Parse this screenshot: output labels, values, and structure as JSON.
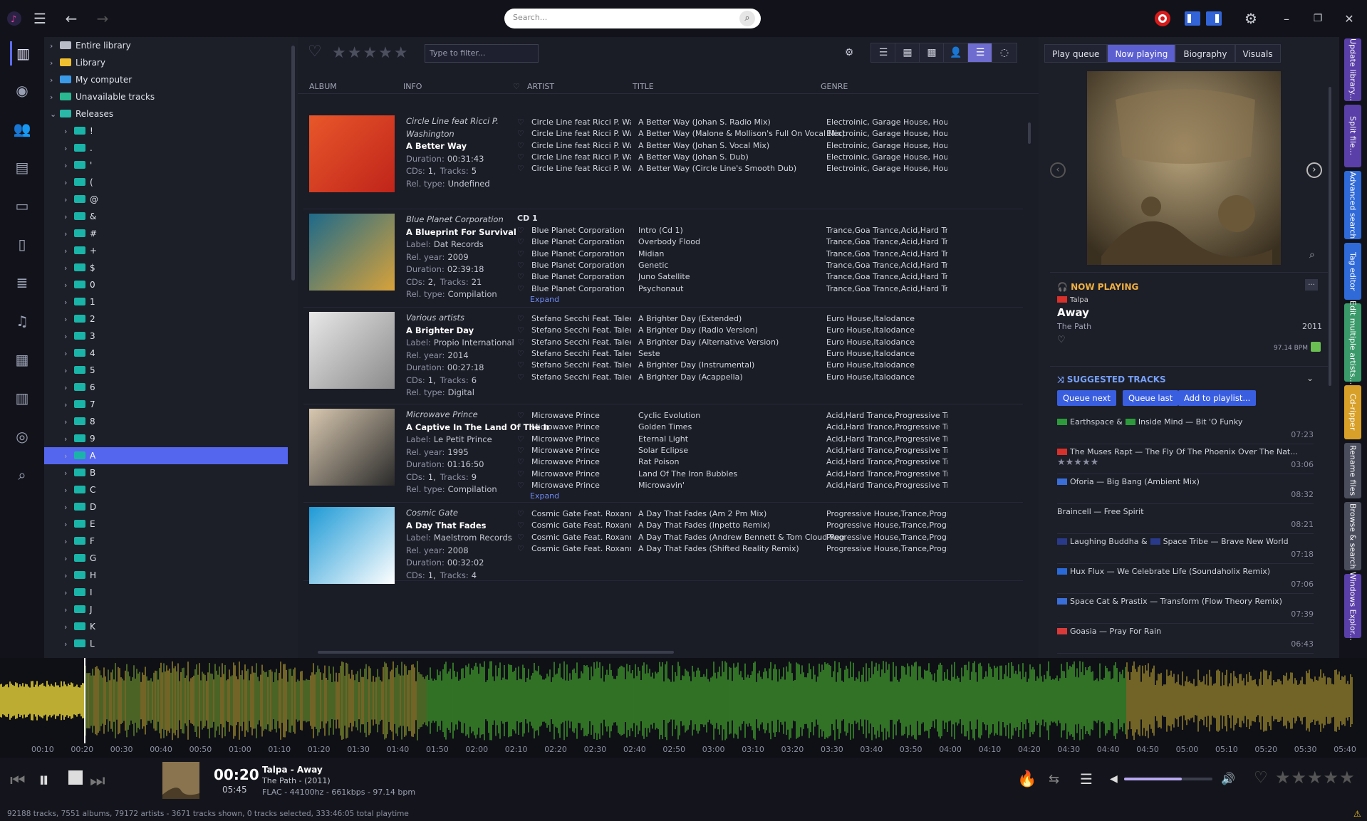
{
  "app": {
    "logo": "musicbee-logo"
  },
  "topbar": {
    "search_placeholder": "Search...",
    "menu_icon": "hamburger-icon",
    "back_icon": "back-arrow-icon",
    "forward_icon": "forward-arrow-icon"
  },
  "tree": {
    "items": [
      {
        "label": "Entire library",
        "level": 0,
        "icon": "database-icon"
      },
      {
        "label": "Library",
        "level": 0,
        "icon": "folder-icon"
      },
      {
        "label": "My computer",
        "level": 0,
        "icon": "computer-icon"
      },
      {
        "label": "Unavailable tracks",
        "level": 0,
        "icon": "unavailable-icon"
      },
      {
        "label": "Releases",
        "level": 0,
        "icon": "releases-icon",
        "expanded": true
      }
    ],
    "release_folders": [
      "!",
      ".",
      "'",
      "(",
      "@",
      "&",
      "#",
      "+",
      "$",
      "0",
      "1",
      "2",
      "3",
      "4",
      "5",
      "6",
      "7",
      "8",
      "9",
      "A",
      "B",
      "C",
      "D",
      "E",
      "F",
      "G",
      "H",
      "I",
      "J",
      "K",
      "L"
    ],
    "selected": "A"
  },
  "center": {
    "filter_placeholder": "Type to filter...",
    "columns": {
      "album": "ALBUM",
      "info": "INFO",
      "artist": "ARTIST",
      "title": "TITLE",
      "genre": "GENRE"
    },
    "expand_label": "Expand",
    "albums": [
      {
        "artist": "Circle Line feat Ricci P. Washington",
        "title": "A Better Way",
        "duration_label": "Duration:",
        "duration": "00:31:43",
        "cds_label": "CDs:",
        "cds": "1,",
        "tracks_label": "Tracks:",
        "tracks": "5",
        "reltype_label": "Rel. type:",
        "reltype": "Undefined",
        "colors": [
          "#e8572a",
          "#c0241a"
        ],
        "rows": [
          {
            "artist": "Circle Line feat Ricci P. Wa...",
            "title": "A Better Way (Johan S. Radio Mix)",
            "genre": "Electroinic, Garage House, House"
          },
          {
            "artist": "Circle Line feat Ricci P. Wa...",
            "title": "A Better Way (Malone & Mollison's Full On Vocal Mix)",
            "genre": "Electroinic, Garage House, House"
          },
          {
            "artist": "Circle Line feat Ricci P. Wa...",
            "title": "A Better Way (Johan S. Vocal Mix)",
            "genre": "Electroinic, Garage House, House"
          },
          {
            "artist": "Circle Line feat Ricci P. Wa...",
            "title": "A Better Way (Johan S. Dub)",
            "genre": "Electroinic, Garage House, House"
          },
          {
            "artist": "Circle Line feat Ricci P. Wa...",
            "title": "A Better Way (Circle Line's Smooth Dub)",
            "genre": "Electroinic, Garage House, House"
          }
        ]
      },
      {
        "artist": "Blue Planet Corporation",
        "title": "A Blueprint For Survival",
        "label_label": "Label:",
        "label": "Dat Records",
        "year_label": "Rel. year:",
        "year": "2009",
        "duration_label": "Duration:",
        "duration": "02:39:18",
        "cds_label": "CDs:",
        "cds": "2,",
        "tracks_label": "Tracks:",
        "tracks": "21",
        "reltype_label": "Rel. type:",
        "reltype": "Compilation",
        "cd": "CD 1",
        "colors": [
          "#1d6a8a",
          "#d8a23a"
        ],
        "rows": [
          {
            "artist": "Blue Planet Corporation",
            "title": "Intro (Cd 1)",
            "genre": "Trance,Goa Trance,Acid,Hard Tra..."
          },
          {
            "artist": "Blue Planet Corporation",
            "title": "Overbody Flood",
            "genre": "Trance,Goa Trance,Acid,Hard Tra..."
          },
          {
            "artist": "Blue Planet Corporation",
            "title": "Midian",
            "genre": "Trance,Goa Trance,Acid,Hard Tra..."
          },
          {
            "artist": "Blue Planet Corporation",
            "title": "Genetic",
            "genre": "Trance,Goa Trance,Acid,Hard Tra..."
          },
          {
            "artist": "Blue Planet Corporation",
            "title": "Juno Satellite",
            "genre": "Trance,Goa Trance,Acid,Hard Tra..."
          },
          {
            "artist": "Blue Planet Corporation",
            "title": "Psychonaut",
            "genre": "Trance,Goa Trance,Acid,Hard Tra..."
          }
        ]
      },
      {
        "artist": "Various artists",
        "title": "A Brighter Day",
        "label_label": "Label:",
        "label": "Propio International",
        "year_label": "Rel. year:",
        "year": "2014",
        "duration_label": "Duration:",
        "duration": "00:27:18",
        "cds_label": "CDs:",
        "cds": "1,",
        "tracks_label": "Tracks:",
        "tracks": "6",
        "reltype_label": "Rel. type:",
        "reltype": "Digital",
        "colors": [
          "#e8e8e8",
          "#8a8a8a"
        ],
        "rows": [
          {
            "artist": "Stefano Secchi Feat. Taleesa",
            "title": "A Brighter Day (Extended)",
            "genre": "Euro House,Italodance"
          },
          {
            "artist": "Stefano Secchi Feat. Taleesa",
            "title": "A Brighter Day (Radio Version)",
            "genre": "Euro House,Italodance"
          },
          {
            "artist": "Stefano Secchi Feat. Taleesa",
            "title": "A Brighter Day (Alternative Version)",
            "genre": "Euro House,Italodance"
          },
          {
            "artist": "Stefano Secchi Feat. Taleesa",
            "title": "Seste",
            "genre": "Euro House,Italodance"
          },
          {
            "artist": "Stefano Secchi Feat. Taleesa",
            "title": "A Brighter Day (Instrumental)",
            "genre": "Euro House,Italodance"
          },
          {
            "artist": "Stefano Secchi Feat. Taleesa",
            "title": "A Brighter Day (Acappella)",
            "genre": "Euro House,Italodance"
          }
        ]
      },
      {
        "artist": "Microwave Prince",
        "title": "A Captive In The Land Of The Iro...",
        "label_label": "Label:",
        "label": "Le Petit Prince",
        "year_label": "Rel. year:",
        "year": "1995",
        "duration_label": "Duration:",
        "duration": "01:16:50",
        "cds_label": "CDs:",
        "cds": "1,",
        "tracks_label": "Tracks:",
        "tracks": "9",
        "reltype_label": "Rel. type:",
        "reltype": "Compilation",
        "colors": [
          "#d8c8b0",
          "#2a2a2a"
        ],
        "rows": [
          {
            "artist": "Microwave Prince",
            "title": "Cyclic Evolution",
            "genre": "Acid,Hard Trance,Progressive Tra..."
          },
          {
            "artist": "Microwave Prince",
            "title": "Golden Times",
            "genre": "Acid,Hard Trance,Progressive Tra..."
          },
          {
            "artist": "Microwave Prince",
            "title": "Eternal Light",
            "genre": "Acid,Hard Trance,Progressive Tra..."
          },
          {
            "artist": "Microwave Prince",
            "title": "Solar Eclipse",
            "genre": "Acid,Hard Trance,Progressive Tra..."
          },
          {
            "artist": "Microwave Prince",
            "title": "Rat Poison",
            "genre": "Acid,Hard Trance,Progressive Tra..."
          },
          {
            "artist": "Microwave Prince",
            "title": "Land Of The Iron Bubbles",
            "genre": "Acid,Hard Trance,Progressive Tra..."
          },
          {
            "artist": "Microwave Prince",
            "title": "Microwavin'",
            "genre": "Acid,Hard Trance,Progressive Tra..."
          }
        ]
      },
      {
        "artist": "Cosmic Gate",
        "title": "A Day That Fades",
        "label_label": "Label:",
        "label": "Maelstrom Records",
        "year_label": "Rel. year:",
        "year": "2008",
        "duration_label": "Duration:",
        "duration": "00:32:02",
        "cds_label": "CDs:",
        "cds": "1,",
        "tracks_label": "Tracks:",
        "tracks": "4",
        "colors": [
          "#1e9ad6",
          "#ffffff"
        ],
        "rows": [
          {
            "artist": "Cosmic Gate Feat. Roxann...",
            "title": "A Day That Fades (Am 2 Pm Mix)",
            "genre": "Progressive House,Trance,Progr..."
          },
          {
            "artist": "Cosmic Gate Feat. Roxann...",
            "title": "A Day That Fades (Inpetto Remix)",
            "genre": "Progressive House,Trance,Progr..."
          },
          {
            "artist": "Cosmic Gate Feat. Roxann...",
            "title": "A Day That Fades (Andrew Bennett & Tom Cloud Remix)",
            "genre": "Progressive House,Trance,Progr..."
          },
          {
            "artist": "Cosmic Gate Feat. Roxann...",
            "title": "A Day That Fades (Shifted Reality Remix)",
            "genre": "Progressive House,Trance,Progr..."
          }
        ]
      }
    ]
  },
  "right": {
    "tabs": [
      "Play queue",
      "Now playing",
      "Biography",
      "Visuals"
    ],
    "selected_tab": "Now playing",
    "now_playing_label": "NOW PLAYING",
    "np_artist": "Talpa",
    "np_title": "Away",
    "np_album": "The Path",
    "np_year": "2011",
    "np_bpm": "97.14 BPM",
    "suggested_label": "SUGGESTED TRACKS",
    "buttons": [
      "Queue next",
      "Queue last",
      "Add to playlist..."
    ],
    "more_label": "...",
    "suggestions": [
      {
        "artist": "Earthspace &",
        "artist2": "Inside Mind",
        "title": "Bit 'O Funky",
        "dur": "07:23",
        "flag": "#2c9a3a",
        "flag2": "#2c9a3a"
      },
      {
        "artist": "The Muses Rapt",
        "title": "The Fly Of The Phoenix Over The Nat...",
        "dur": "03:06",
        "flag": "#d8302a",
        "rated": true
      },
      {
        "artist": "Oforia",
        "title": "Big Bang (Ambient Mix)",
        "dur": "08:32",
        "flag": "#3a6ed8"
      },
      {
        "artist": "Braincell",
        "title": "Free Spirit",
        "dur": "08:21"
      },
      {
        "artist": "Laughing Buddha &",
        "artist2": "Space Tribe",
        "title": "Brave New World",
        "dur": "07:18",
        "flag": "#2a3a8a",
        "flag2": "#2a3a8a"
      },
      {
        "artist": "Hux Flux",
        "title": "We Celebrate Life (Soundaholix Remix)",
        "dur": "07:06",
        "flag": "#2a6ad8"
      },
      {
        "artist": "Space Cat & Prastix",
        "title": "Transform (Flow Theory Remix)",
        "dur": "07:39",
        "flag": "#3a6ed8"
      },
      {
        "artist": "Goasia",
        "title": "Pray For Rain",
        "dur": "06:43",
        "flag": "#d83a3a"
      }
    ]
  },
  "side_tabs": [
    {
      "label": "Update library...",
      "color": "#5a3fa8"
    },
    {
      "label": "Split file...",
      "color": "#5a3fa8"
    },
    {
      "label": "Advanced search",
      "color": "#2f6ad8"
    },
    {
      "label": "Tag editor",
      "color": "#2f6ad8"
    },
    {
      "label": "Edit multiple artists...",
      "color": "#3a9a6a"
    },
    {
      "label": "Cd-ripper",
      "color": "#d8a028"
    },
    {
      "label": "Rename files",
      "color": "#4a4d5c"
    },
    {
      "label": "Browse & search",
      "color": "#4a4d5c"
    },
    {
      "label": "Windows Explor...",
      "color": "#5a3fa8"
    }
  ],
  "timeline": [
    "00:10",
    "00:20",
    "00:30",
    "00:40",
    "00:50",
    "01:00",
    "01:10",
    "01:20",
    "01:30",
    "01:40",
    "01:50",
    "02:00",
    "02:10",
    "02:20",
    "02:30",
    "02:40",
    "02:50",
    "03:00",
    "03:10",
    "03:20",
    "03:30",
    "03:40",
    "03:50",
    "04:00",
    "04:10",
    "04:20",
    "04:30",
    "04:40",
    "04:50",
    "05:00",
    "05:10",
    "05:20",
    "05:30",
    "05:40"
  ],
  "player": {
    "elapsed": "00:20",
    "total": "05:45",
    "artist_title": "Talpa - Away",
    "album_year": "The Path - (2011)",
    "format": "FLAC - 44100hz - 661kbps - 97.14 bpm",
    "volume": 0.65
  },
  "status": "92188 tracks, 7551 albums, 79172 artists - 3671 tracks shown, 0 tracks selected, 333:46:05 total playtime",
  "colors": {
    "accent": "#5d6cf0",
    "folder": "#1ab4a8",
    "waveform_yellow": "#e8d43a",
    "waveform_green": "#3a8a2a"
  }
}
